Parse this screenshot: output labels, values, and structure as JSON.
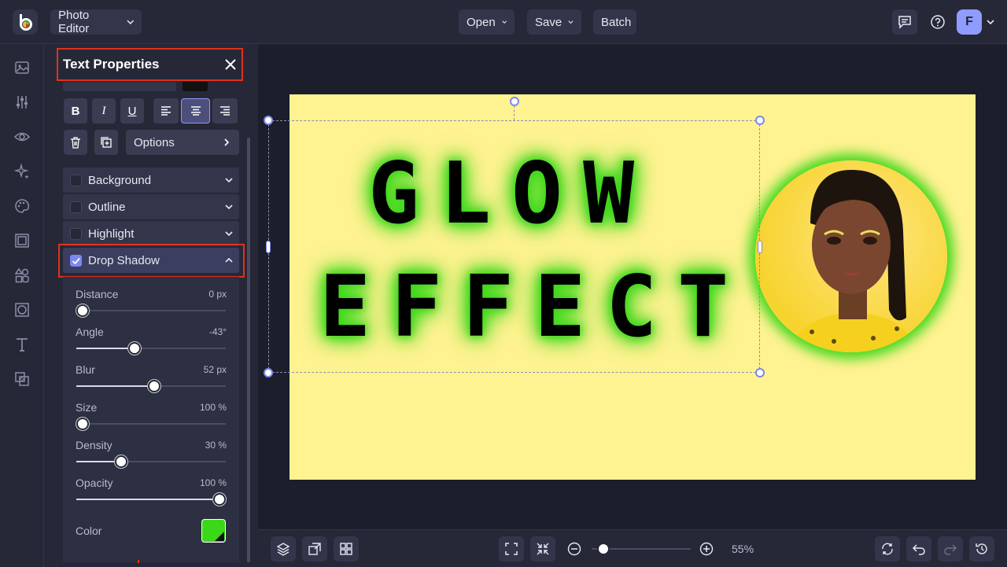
{
  "topbar": {
    "editor_label": "Photo Editor",
    "open_label": "Open",
    "save_label": "Save",
    "batch_label": "Batch",
    "avatar_initial": "F"
  },
  "panel": {
    "title": "Text Properties",
    "format_buttons": [
      "B",
      "I",
      "U"
    ],
    "options_label": "Options",
    "sections": [
      "Background",
      "Outline",
      "Highlight",
      "Drop Shadow"
    ],
    "drop_shadow_checked": true,
    "sliders": [
      {
        "label": "Distance",
        "value": "0 px",
        "fraction": 0.0
      },
      {
        "label": "Angle",
        "value": "-43°",
        "fraction": 0.39
      },
      {
        "label": "Blur",
        "value": "52 px",
        "fraction": 0.52
      },
      {
        "label": "Size",
        "value": "100 %",
        "fraction": 0.0
      },
      {
        "label": "Density",
        "value": "30 %",
        "fraction": 0.3
      },
      {
        "label": "Opacity",
        "value": "100 %",
        "fraction": 1.0
      }
    ],
    "color_label": "Color",
    "shadow_color": "#3bd819"
  },
  "canvas": {
    "line1": "GLOW",
    "line2": "EFFECT",
    "bg_color": "#fff291",
    "glow_color": "#3bd819"
  },
  "bottombar": {
    "zoom_value": "55%",
    "zoom_fraction": 0.06
  }
}
